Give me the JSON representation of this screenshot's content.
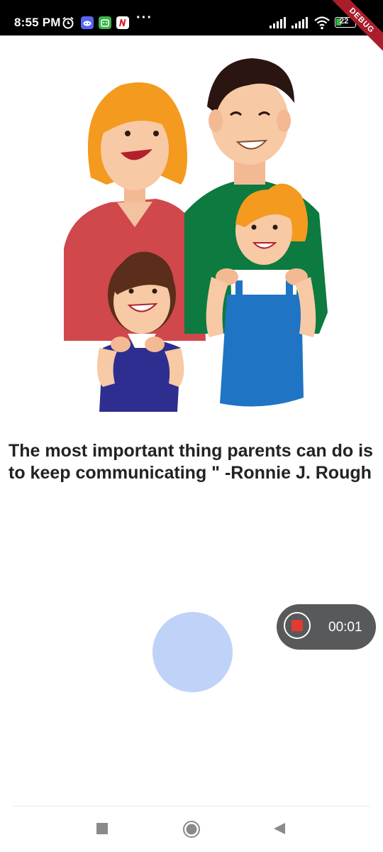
{
  "status_bar": {
    "time": "8:55 PM",
    "battery": "22",
    "debug_label": "DEBUG",
    "icons": [
      "alarm-icon",
      "discord-icon",
      "android-icon",
      "news-icon",
      "more-icon",
      "signal-icon",
      "signal-icon",
      "wifi-icon",
      "battery-icon"
    ]
  },
  "quote": {
    "text": "The most important thing parents can do is to keep communicating \" -Ronnie J. Rough"
  },
  "recorder": {
    "elapsed": "00:01"
  },
  "nav": {
    "icons": [
      "recents-icon",
      "home-icon",
      "back-icon"
    ]
  },
  "colors": {
    "mic": "#bfd2f8",
    "pill": "#58595b",
    "record": "#e53935"
  }
}
